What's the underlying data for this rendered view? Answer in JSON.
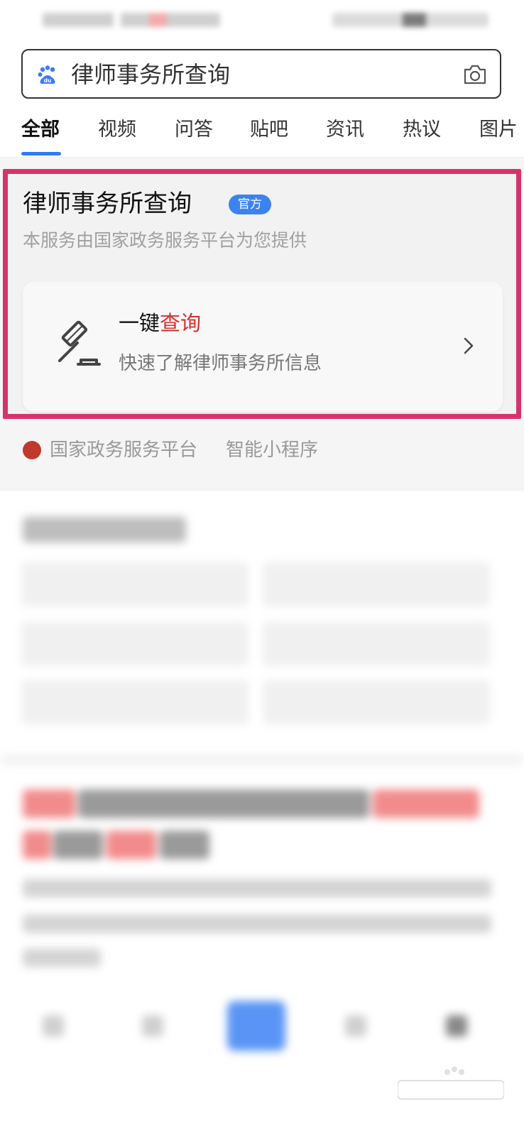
{
  "search": {
    "query": "律师事务所查询"
  },
  "tabs": [
    {
      "label": "全部"
    },
    {
      "label": "视频"
    },
    {
      "label": "问答"
    },
    {
      "label": "贴吧"
    },
    {
      "label": "资讯"
    },
    {
      "label": "热议"
    },
    {
      "label": "图片"
    }
  ],
  "card": {
    "title": "律师事务所查询",
    "badge": "官方",
    "subtitle": "本服务由国家政务服务平台为您提供",
    "action": {
      "title_prefix": "一键",
      "title_highlight": "查询",
      "subtitle": "快速了解律师事务所信息"
    },
    "source": {
      "name": "国家政务服务平台",
      "type": "智能小程序"
    }
  },
  "colors": {
    "accent": "#3478f6",
    "highlight_border": "#d6336c",
    "keyword_red": "#d32f2f",
    "badge_blue": "#3c83f0"
  }
}
